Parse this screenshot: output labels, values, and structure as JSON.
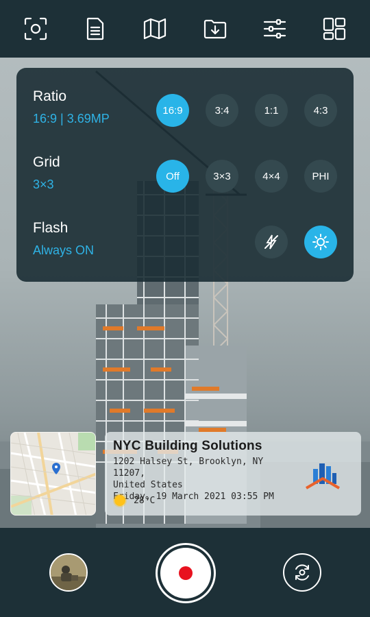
{
  "toolbar": {
    "icons": [
      "focus-scan-icon",
      "document-icon",
      "map-icon",
      "folder-download-icon",
      "settings-sliders-icon",
      "layout-grid-icon"
    ]
  },
  "settings": {
    "ratio": {
      "title": "Ratio",
      "value": "16:9 | 3.69MP",
      "options": [
        "16:9",
        "3:4",
        "1:1",
        "4:3"
      ],
      "selected": "16:9"
    },
    "grid": {
      "title": "Grid",
      "value": "3×3",
      "options": [
        "Off",
        "3×3",
        "4×4",
        "PHI"
      ],
      "selected": "Off"
    },
    "flash": {
      "title": "Flash",
      "value": "Always ON",
      "options": [
        "flash-off-icon",
        "flash-on-icon"
      ],
      "selected": "flash-on-icon"
    }
  },
  "stamp": {
    "company": "NYC Building Solutions",
    "address_line1": "1202 Halsey St, Brooklyn, NY 11207,",
    "address_line2": "United States",
    "datetime": "Friday, 19 March 2021 03:55 PM",
    "temperature": "28°C",
    "weather_icon": "sun-icon",
    "logo": "building-house-logo"
  },
  "colors": {
    "accent": "#29b4e8",
    "bar": "#1d3037",
    "record": "#e8121f"
  }
}
